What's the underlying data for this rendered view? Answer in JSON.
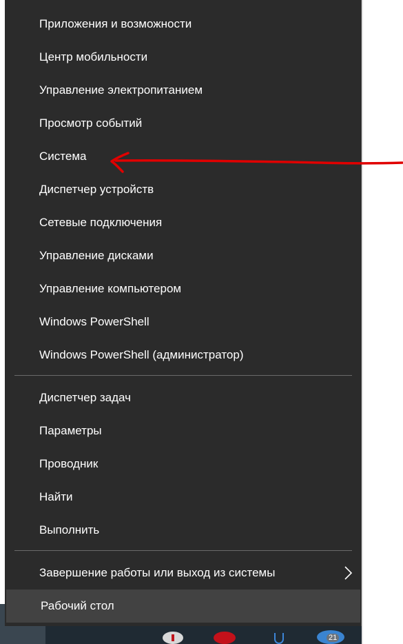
{
  "menu": {
    "group1": [
      {
        "label": "Приложения и возможности"
      },
      {
        "label": "Центр мобильности"
      },
      {
        "label": "Управление электропитанием"
      },
      {
        "label": "Просмотр событий"
      },
      {
        "label": "Система"
      },
      {
        "label": "Диспетчер устройств"
      },
      {
        "label": "Сетевые подключения"
      },
      {
        "label": "Управление дисками"
      },
      {
        "label": "Управление компьютером"
      },
      {
        "label": "Windows PowerShell"
      },
      {
        "label": "Windows PowerShell (администратор)"
      }
    ],
    "group2": [
      {
        "label": "Диспетчер задач"
      },
      {
        "label": "Параметры"
      },
      {
        "label": "Проводник"
      },
      {
        "label": "Найти"
      },
      {
        "label": "Выполнить"
      }
    ],
    "group3": [
      {
        "label": "Завершение работы или выход из системы",
        "submenu_icon": "chevron-right-icon"
      },
      {
        "label": "Рабочий стол"
      }
    ]
  },
  "taskbar": {
    "badge": "21"
  },
  "colors": {
    "menu_background": "#2b2b2b",
    "menu_text": "#ffffff",
    "hover_background": "#424242",
    "annotation": "#e00000"
  }
}
